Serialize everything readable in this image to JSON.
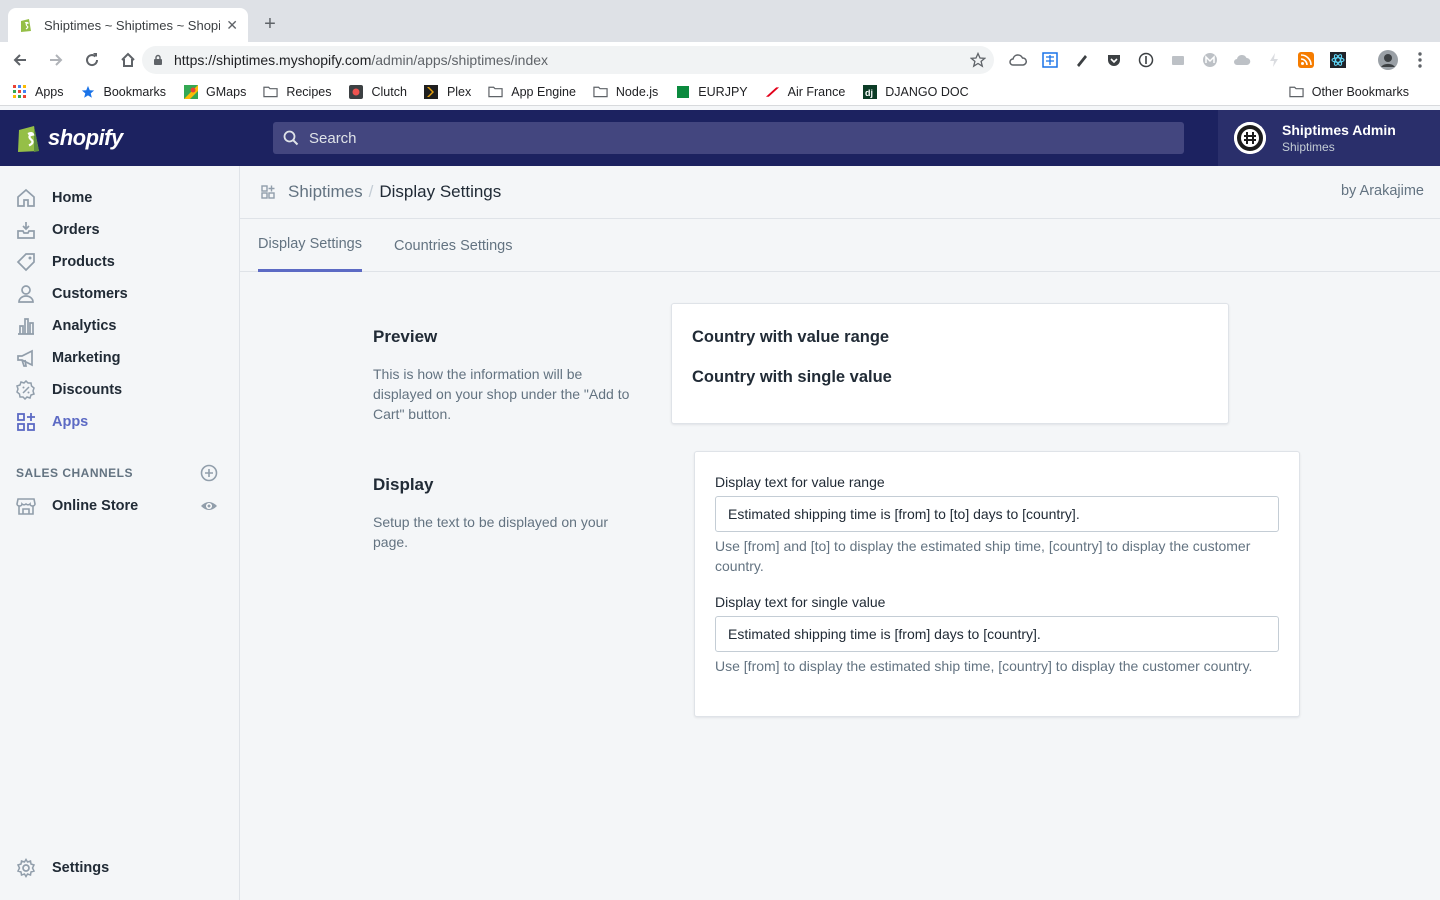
{
  "browser": {
    "tab_title": "Shiptimes ~ Shiptimes ~ Shopify",
    "close_glyph": "✕",
    "new_tab_glyph": "+",
    "url_host": "https://shiptimes.myshopify.com",
    "url_path": "/admin/apps/shiptimes/index",
    "bookmarks": [
      {
        "label": "Apps",
        "icon": "apps-grid-icon"
      },
      {
        "label": "Bookmarks",
        "icon": "star-icon"
      },
      {
        "label": "GMaps",
        "icon": "maps-icon"
      },
      {
        "label": "Recipes",
        "icon": "folder-icon"
      },
      {
        "label": "Clutch",
        "icon": "clutch-icon"
      },
      {
        "label": "Plex",
        "icon": "plex-icon"
      },
      {
        "label": "App Engine",
        "icon": "folder-icon"
      },
      {
        "label": "Node.js",
        "icon": "folder-icon"
      },
      {
        "label": "EURJPY",
        "icon": "chart-icon"
      },
      {
        "label": "Air France",
        "icon": "airfrance-icon"
      },
      {
        "label": "DJANGO DOC",
        "icon": "django-icon"
      }
    ],
    "other_bookmarks": "Other Bookmarks"
  },
  "topbar": {
    "logo": "shopify",
    "search_placeholder": "Search",
    "user_name": "Shiptimes Admin",
    "user_shop": "Shiptimes"
  },
  "sidebar": {
    "items": [
      {
        "label": "Home",
        "icon": "home-icon"
      },
      {
        "label": "Orders",
        "icon": "orders-icon"
      },
      {
        "label": "Products",
        "icon": "tag-icon"
      },
      {
        "label": "Customers",
        "icon": "person-icon"
      },
      {
        "label": "Analytics",
        "icon": "bar-chart-icon"
      },
      {
        "label": "Marketing",
        "icon": "megaphone-icon"
      },
      {
        "label": "Discounts",
        "icon": "discount-icon"
      },
      {
        "label": "Apps",
        "icon": "apps-icon"
      }
    ],
    "sales_channels_heading": "SALES CHANNELS",
    "online_store": "Online Store",
    "settings": "Settings"
  },
  "header": {
    "app_name": "Shiptimes",
    "separator": "/",
    "page_title": "Display Settings",
    "by_author": "by Arakajime"
  },
  "tabs": [
    {
      "label": "Display Settings",
      "active": true
    },
    {
      "label": "Countries Settings",
      "active": false
    }
  ],
  "preview": {
    "title": "Preview",
    "description": "This is how the information will be displayed on your shop under the \"Add to Cart\" button.",
    "line_range": "Country with value range",
    "line_single": "Country with single value"
  },
  "display": {
    "title": "Display",
    "description": "Setup the text to be displayed on your page.",
    "range_label": "Display text for value range",
    "range_value": "Estimated shipping time is [from] to [to] days to [country].",
    "range_help": "Use [from] and [to] to display the estimated ship time, [country] to display the customer country.",
    "single_label": "Display text for single value",
    "single_value": "Estimated shipping time is [from] days to [country].",
    "single_help": "Use [from] to display the estimated ship time, [country] to display the customer country."
  },
  "colors": {
    "topbar": "#1c2260",
    "accent": "#5c6ac4",
    "text": "#212b36",
    "subdued": "#637381"
  }
}
